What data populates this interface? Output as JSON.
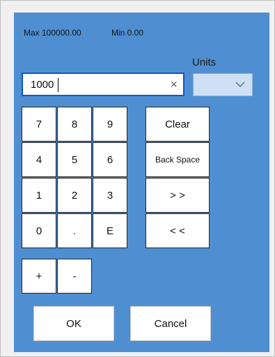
{
  "range": {
    "max_label": "Max 100000.00",
    "min_label": "Min 0.00"
  },
  "units": {
    "label": "Units",
    "selected_value": "",
    "icon": "chevron-down-icon"
  },
  "input": {
    "value": "1000",
    "clear_icon": "×"
  },
  "keypad": {
    "rows": [
      [
        "7",
        "8",
        "9"
      ],
      [
        "4",
        "5",
        "6"
      ],
      [
        "1",
        "2",
        "3"
      ],
      [
        "0",
        ".",
        "E"
      ]
    ],
    "sign": [
      "+",
      "-"
    ]
  },
  "actions": {
    "clear": "Clear",
    "backspace": "Back Space",
    "forward": "> >",
    "back": "< <"
  },
  "buttons": {
    "ok": "OK",
    "cancel": "Cancel"
  },
  "colors": {
    "panel": "#4f8fd1",
    "input_border": "#0a58c9",
    "units_fill": "#cfe0f5"
  }
}
